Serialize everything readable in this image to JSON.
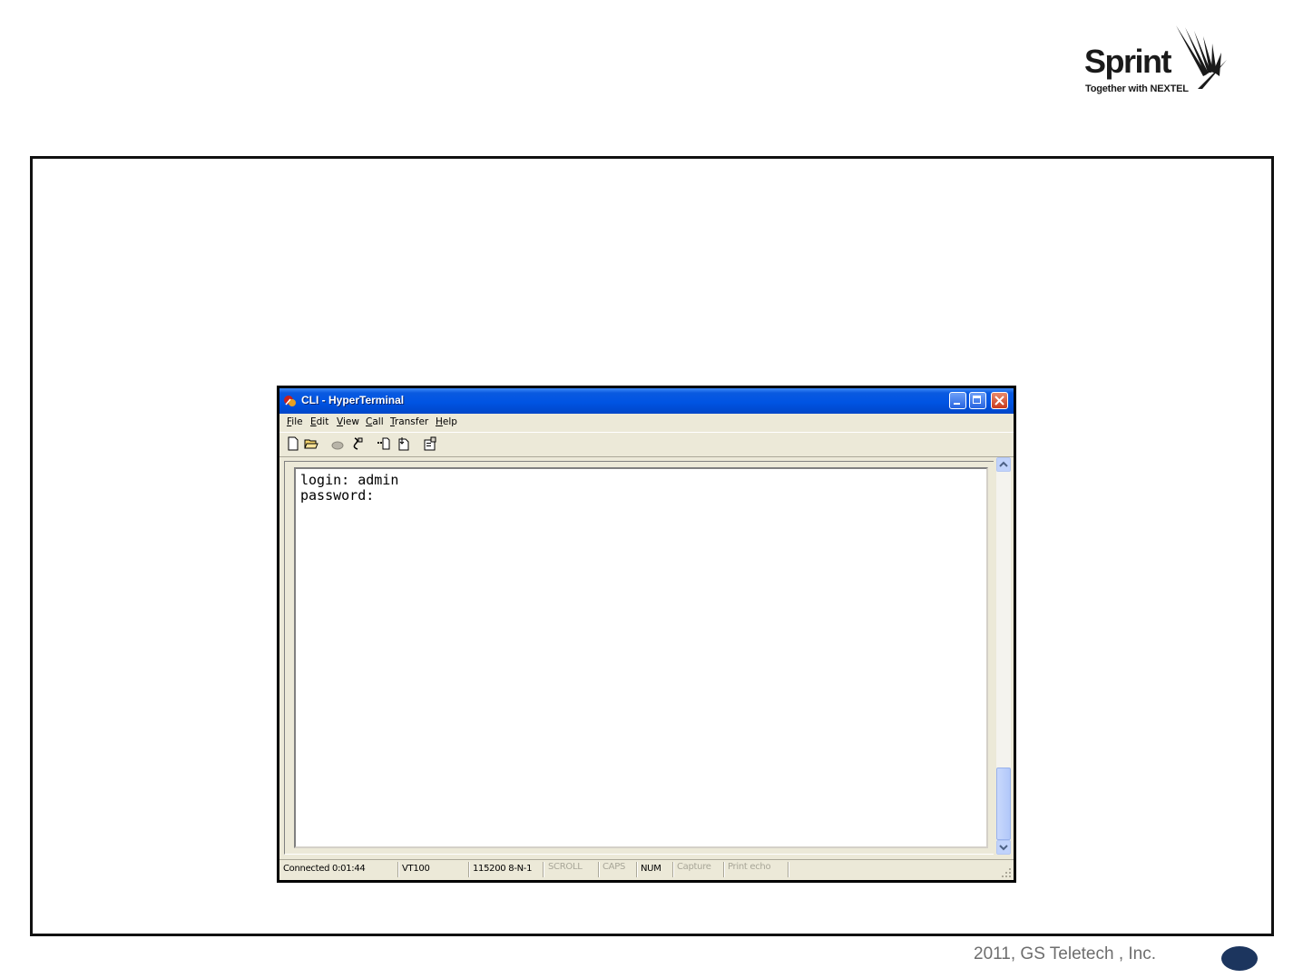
{
  "logo": {
    "word": "Sprint",
    "tagline": "Together with NEXTEL"
  },
  "window": {
    "title": "CLI - HyperTerminal",
    "menu": [
      "File",
      "Edit",
      "View",
      "Call",
      "Transfer",
      "Help"
    ],
    "toolbar_icons": [
      "new-icon",
      "open-icon",
      "dial-icon",
      "disconnect-icon",
      "send-icon",
      "receive-icon",
      "properties-icon"
    ],
    "terminal_lines": [
      "login: admin",
      "password:"
    ],
    "status": {
      "connected": "Connected 0:01:44",
      "emulation": "VT100",
      "settings": "115200 8-N-1",
      "scroll": "SCROLL",
      "caps": "CAPS",
      "num": "NUM",
      "capture": "Capture",
      "print_echo": "Print echo"
    }
  },
  "footer": {
    "copyright": "2011, GS Teletech , Inc."
  },
  "colors": {
    "titlebar": "#0054e3",
    "window_bg": "#ece9d8",
    "page_oval": "#1c355e"
  }
}
